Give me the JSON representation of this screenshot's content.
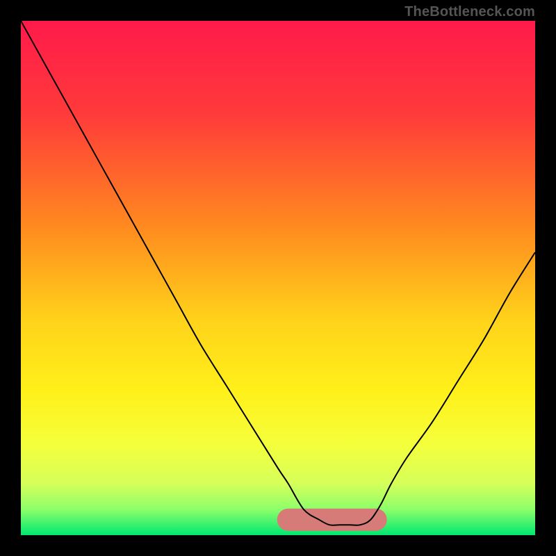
{
  "attribution": "TheBottleneck.com",
  "colors": {
    "frame": "#000000",
    "curve": "#000000",
    "band": "#d77b78",
    "gradient_stops": [
      {
        "offset": 0.0,
        "color": "#ff1a4b"
      },
      {
        "offset": 0.18,
        "color": "#ff3a3a"
      },
      {
        "offset": 0.4,
        "color": "#ff8a1f"
      },
      {
        "offset": 0.58,
        "color": "#ffd21a"
      },
      {
        "offset": 0.72,
        "color": "#fff01a"
      },
      {
        "offset": 0.82,
        "color": "#f5ff3a"
      },
      {
        "offset": 0.9,
        "color": "#d6ff5a"
      },
      {
        "offset": 0.95,
        "color": "#8cff6a"
      },
      {
        "offset": 1.0,
        "color": "#00e870"
      }
    ]
  },
  "chart_data": {
    "type": "line",
    "title": "",
    "xlabel": "",
    "ylabel": "",
    "xlim": [
      0,
      100
    ],
    "ylim": [
      0,
      100
    ],
    "comment": "V-shaped bottleneck curve; values are bottleneck % vs configuration position. Valley ≈ x 55–68, y ≈ 2. Read off from the plotted curve against the 0–100 deviation gradient.",
    "x": [
      0,
      5,
      10,
      15,
      20,
      25,
      30,
      35,
      40,
      45,
      50,
      52,
      55,
      58,
      60,
      62,
      64,
      66,
      68,
      70,
      72,
      75,
      80,
      85,
      90,
      95,
      100
    ],
    "values": [
      100,
      91,
      82,
      73,
      64,
      55,
      46,
      37,
      29,
      21,
      13,
      10,
      5,
      3,
      2,
      2,
      2,
      2,
      3,
      6,
      10,
      15,
      22,
      30,
      38,
      47,
      55
    ],
    "sweet_spot_band": {
      "x_start": 52,
      "x_end": 69,
      "y": 3,
      "thickness": 3
    },
    "sweet_marker": {
      "x": 69,
      "y": 4
    }
  }
}
